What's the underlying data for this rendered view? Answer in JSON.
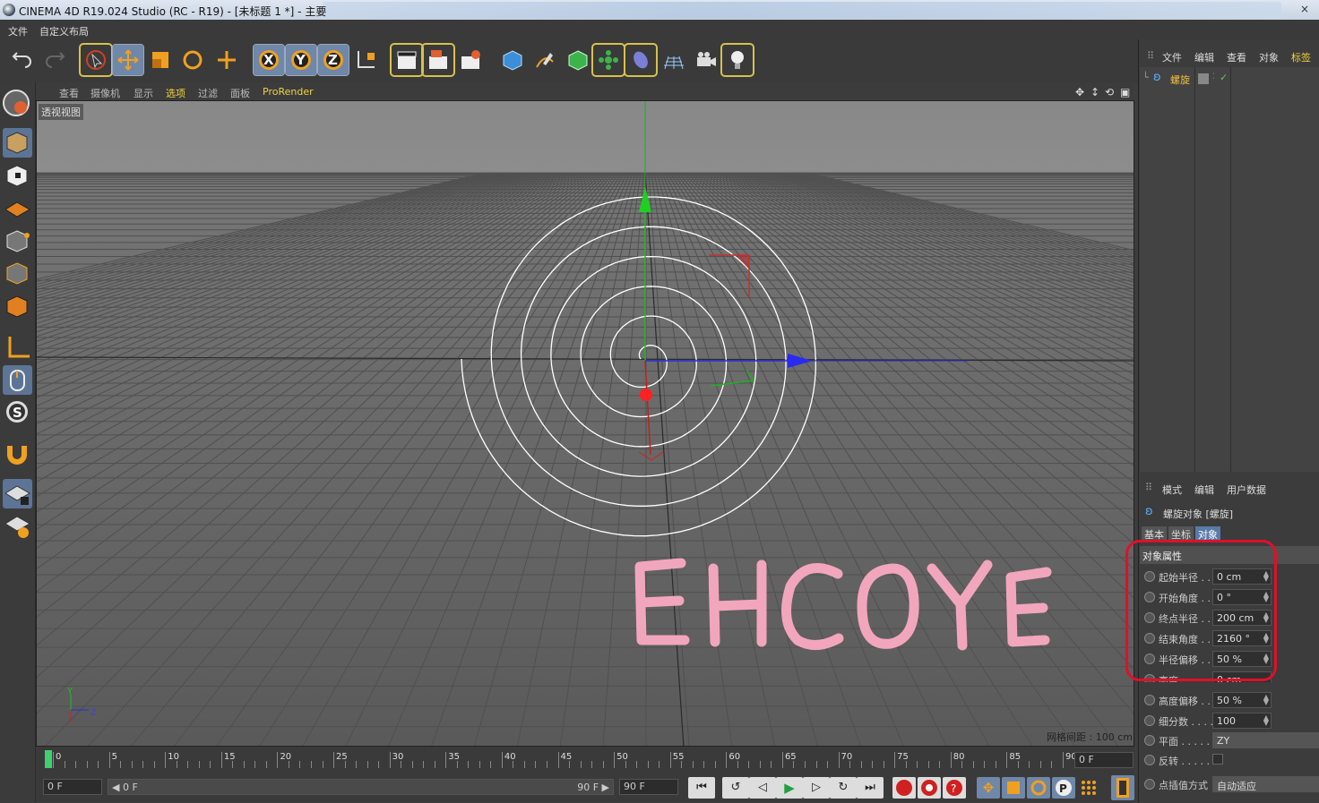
{
  "window": {
    "title": "CINEMA 4D R19.024 Studio (RC - R19) - [未标题 1 *] - 主要",
    "close": "×"
  },
  "menu": {
    "file": "文件",
    "layout": "自定义布局"
  },
  "viewport_menu": [
    "查看",
    "摄像机",
    "显示",
    "选项",
    "过滤",
    "面板",
    "ProRender"
  ],
  "viewport": {
    "label": "透视视图",
    "grid_info": "网格间距 : 100 cm",
    "accent": "#f0d23c"
  },
  "axes_icon": {
    "y": "Y",
    "z": "Z"
  },
  "toolbar": {
    "axis_x": "X",
    "axis_y": "Y",
    "axis_z": "Z"
  },
  "timeline": {
    "ticks": [
      "0",
      "5",
      "10",
      "15",
      "20",
      "25",
      "30",
      "35",
      "40",
      "45",
      "50",
      "55",
      "60",
      "65",
      "70",
      "75",
      "80",
      "85",
      "90"
    ],
    "current_frame": "0 F"
  },
  "transport": {
    "start": "0 F",
    "range_start": "◀ 0 F",
    "range_end": "90 F ▶",
    "end": "90 F"
  },
  "object_manager": {
    "menu": [
      "文件",
      "编辑",
      "查看",
      "对象",
      "标签"
    ],
    "objects": [
      {
        "name": "螺旋",
        "visible": "✓"
      }
    ]
  },
  "attributes": {
    "menu": [
      "模式",
      "编辑",
      "用户数据"
    ],
    "object_title": "螺旋对象 [螺旋]",
    "tabs": [
      "基本",
      "坐标",
      "对象"
    ],
    "section": "对象属性",
    "rows": [
      {
        "label": "起始半径 . .",
        "value": "0 cm"
      },
      {
        "label": "开始角度 . .",
        "value": "0 °"
      },
      {
        "label": "终点半径 . .",
        "value": "200 cm"
      },
      {
        "label": "结束角度 . .",
        "value": "2160 °"
      },
      {
        "label": "半径偏移 . .",
        "value": "50 %"
      },
      {
        "label": "高度 . . . . .",
        "value": "0 cm"
      },
      {
        "label": "高度偏移 . .",
        "value": "50 %"
      },
      {
        "label": "细分数 . . . .",
        "value": "100"
      },
      {
        "label": "平面 . . . . .",
        "value": "ZY"
      },
      {
        "label": "反转 . . . . .",
        "value": ""
      },
      {
        "label": "点插值方式",
        "value": "自动适应"
      }
    ]
  },
  "watermark": "EHCOYE"
}
